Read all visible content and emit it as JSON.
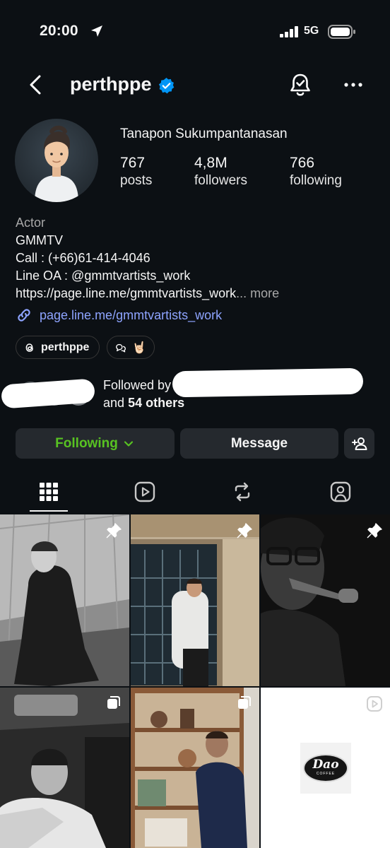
{
  "status_bar": {
    "time": "20:00",
    "network": "5G"
  },
  "header": {
    "username": "perthppe"
  },
  "profile": {
    "full_name": "Tanapon Sukumpantanasan",
    "stats": [
      {
        "value": "767",
        "label": "posts"
      },
      {
        "value": "4,8M",
        "label": "followers"
      },
      {
        "value": "766",
        "label": "following"
      }
    ]
  },
  "bio": {
    "category": "Actor",
    "lines": [
      "GMMTV",
      "Call : (+66)61-414-4046",
      "Line OA : @gmmtvartists_work",
      "https://page.line.me/gmmtvartists_work"
    ],
    "truncation": "...",
    "more_label": "more",
    "link": "page.line.me/gmmtvartists_work"
  },
  "chips": {
    "threads_handle": "perthppe",
    "emoji": "🤘🏻"
  },
  "followed_by": {
    "prefix": "Followed by",
    "and_label": "and",
    "others": "54 others"
  },
  "actions": {
    "following_label": "Following",
    "message_label": "Message"
  },
  "grid": {
    "posts": [
      {
        "kind": "photo",
        "pinned": true
      },
      {
        "kind": "photo",
        "pinned": true
      },
      {
        "kind": "photo",
        "pinned": true
      },
      {
        "kind": "carousel",
        "pinned": false
      },
      {
        "kind": "carousel",
        "pinned": false
      },
      {
        "kind": "reel",
        "pinned": false
      }
    ],
    "logo_text": "Dao",
    "logo_subtext": "COFFEE"
  },
  "colors": {
    "background": "#0c1014",
    "following_green": "#58c322",
    "link_blue": "#8ea4ff",
    "verified_blue": "#0095f6",
    "button_bg": "#25292e"
  },
  "icons": {
    "status": [
      "location-arrow-icon",
      "signal-icon",
      "battery-icon"
    ],
    "header": [
      "back-icon",
      "verified-icon",
      "notification-bell-icon",
      "more-options-icon"
    ],
    "tabs": [
      "grid-icon",
      "reels-icon",
      "reposts-icon",
      "tagged-icon"
    ]
  }
}
